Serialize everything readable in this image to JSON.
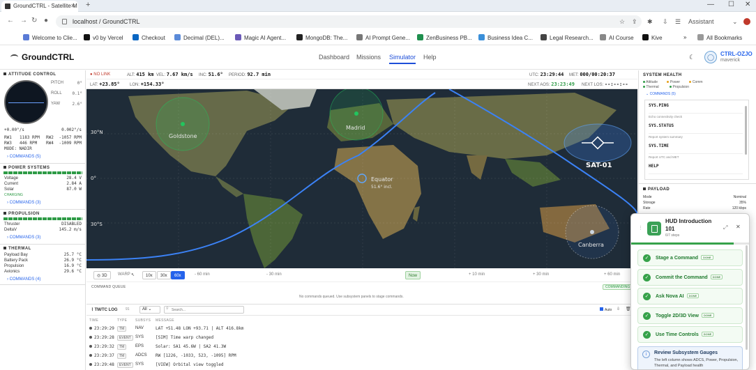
{
  "browser": {
    "tab_title": "GroundCTRL - Satellite M",
    "url": "localhost / GroundCTRL",
    "assistant_label": "Assistant",
    "bookmarks": [
      {
        "label": "Welcome to Clie...",
        "color": "#5a7bd6"
      },
      {
        "label": "v0 by Vercel",
        "color": "#111111"
      },
      {
        "label": "Checkout",
        "color": "#0a66c2"
      },
      {
        "label": "Decimal (DEL)...",
        "color": "#5b8bd9"
      },
      {
        "label": "Magic AI Agent...",
        "color": "#6b5ab8"
      },
      {
        "label": "MongoDB: The...",
        "color": "#222222"
      },
      {
        "label": "AI Prompt Gene...",
        "color": "#777777"
      },
      {
        "label": "ZenBusiness PB...",
        "color": "#1f8f4e"
      },
      {
        "label": "Business Idea C...",
        "color": "#3a8fd9"
      },
      {
        "label": "Legal Research...",
        "color": "#444444"
      },
      {
        "label": "AI Course",
        "color": "#888888"
      },
      {
        "label": "Kive",
        "color": "#111111"
      }
    ],
    "all_bookmarks": "All Bookmarks"
  },
  "app": {
    "name": "GroundCTRL",
    "nav": [
      "Dashboard",
      "Missions",
      "Simulator",
      "Help"
    ],
    "active_nav": "Simulator",
    "user_name": "CTRL-OZJO",
    "user_sub": "maverick"
  },
  "attitude": {
    "title": "ATTITUDE CONTROL",
    "pitch_label": "PITCH",
    "pitch": "0°",
    "roll_label": "ROLL",
    "roll": "0.1°",
    "yaw_label": "YAW",
    "yaw": "2.6°",
    "rate1": "+0.00°/s",
    "rate2": "0.002°/s",
    "rw1_label": "RW1",
    "rw1": "1183 RPM",
    "rw2_label": "RW2",
    "rw2": "-1057 RPM",
    "rw3_label": "RW3",
    "rw3": "446 RPM",
    "rw4_label": "RW4",
    "rw4": "-1009 RPM",
    "mode": "MODE: NADIR",
    "commands": "COMMANDS (5)"
  },
  "power": {
    "title": "POWER SYSTEMS",
    "voltage_label": "Voltage",
    "voltage": "28.4 V",
    "current_label": "Current",
    "current": "2.84 A",
    "solar_label": "Solar",
    "solar": "87.0 W",
    "status": "CHARGING",
    "commands": "COMMANDS (3)"
  },
  "propulsion": {
    "title": "PROPULSION",
    "thruster_label": "Thruster",
    "thruster": "DISABLED",
    "deltav_label": "DeltaV",
    "deltav": "145.2 m/s",
    "commands": "COMMANDS (3)"
  },
  "thermal": {
    "title": "THERMAL",
    "rows": [
      {
        "label": "Payload Bay",
        "value": "25.7 °C"
      },
      {
        "label": "Battery Pack",
        "value": "26.9 °C"
      },
      {
        "label": "Propulsion",
        "value": "16.9 °C"
      },
      {
        "label": "Avionics",
        "value": "29.6 °C"
      }
    ],
    "commands": "COMMANDS (4)"
  },
  "telemetry": {
    "link": "NO LINK",
    "alt_label": "ALT:",
    "alt": "415 km",
    "vel_label": "VEL:",
    "vel": "7.67 km/s",
    "inc_label": "INC:",
    "inc": "51.6°",
    "period_label": "PERIOD:",
    "period": "92.7 min",
    "utc_label": "UTC:",
    "utc": "23:29:44",
    "met_label": "MET:",
    "met": "000/00:20:37",
    "lat_label": "LAT:",
    "lat": "+23.85°",
    "lon_label": "LON:",
    "lon": "+154.33°",
    "next_aos_label": "NEXT AOS:",
    "next_aos": "23:23:49",
    "next_los_label": "NEXT LOS:",
    "next_los": "--:--:--"
  },
  "map": {
    "stations": [
      "Goldstone",
      "Madrid",
      "Canberra"
    ],
    "satellite": "SAT-01",
    "equator_label": "Equator",
    "incl_label": "51.6° incl.",
    "lat_labels": [
      "30°N",
      "0°",
      "30°S"
    ]
  },
  "timebar": {
    "view_3d": "3D",
    "warp_label": "WARP",
    "warp_options": [
      "10x",
      "30x",
      "60x"
    ],
    "active_warp": "60x",
    "ticks": [
      "- 60 min",
      "- 30 min",
      "Now",
      "+ 10 min",
      "+ 30 min",
      "+ 60 min"
    ]
  },
  "queue": {
    "title": "COMMAND QUEUE",
    "empty": "No commands queued. Use subsystem panels to stage commands.",
    "commanding": "COMMANDING"
  },
  "log": {
    "title": "TM/TC LOG",
    "count": "91",
    "filter": "All",
    "search_placeholder": "Search...",
    "auto": "Auto",
    "columns": [
      "TIME",
      "TYPE",
      "SUBSYS",
      "MESSAGE"
    ],
    "rows": [
      {
        "time": "23:29:29",
        "type": "TM",
        "sub": "NAV",
        "msg": "LAT +51.48 LON +93.71 | ALT 416.8km"
      },
      {
        "time": "23:29:28",
        "type": "EVENT",
        "sub": "SYS",
        "msg": "[SIM] Time warp changed"
      },
      {
        "time": "23:29:32",
        "type": "TM",
        "sub": "EPS",
        "msg": "Solar: SA1 45.6W | SA2 41.3W"
      },
      {
        "time": "23:29:37",
        "type": "TM",
        "sub": "ADCS",
        "msg": "RW [1226, -1033, 523, -1095] RPM"
      },
      {
        "time": "23:29:48",
        "type": "EVENT",
        "sub": "SYS",
        "msg": "[VIEW] Orbital view toggled"
      }
    ]
  },
  "system_health": {
    "title": "SYSTEM HEALTH",
    "legend": [
      "Attitude",
      "Power",
      "Comm",
      "Thermal",
      "Propulsion"
    ],
    "commands": "COMMANDS (5)",
    "items": [
      {
        "cmd": "SYS.PING",
        "desc": "Echo connectivity check"
      },
      {
        "cmd": "SYS.STATUS",
        "desc": "Report system summary"
      },
      {
        "cmd": "SYS.TIME",
        "desc": "Report UTC and MET"
      },
      {
        "cmd": "HELP",
        "desc": ""
      }
    ]
  },
  "payload": {
    "title": "PAYLOAD",
    "mode_label": "Mode",
    "mode": "Nominal",
    "storage_label": "Storage",
    "storage": "35%",
    "rate_label": "Rate",
    "rate": "120 kbps"
  },
  "hud": {
    "title": "HUD Introduction 101",
    "steps_count": "6/7 steps",
    "progress": 0.86,
    "done_label": "DONE",
    "steps": [
      "Stage a Command",
      "Commit the Command",
      "Ask Nova AI",
      "Toggle 2D/3D View",
      "Use Time Controls"
    ],
    "current_title": "Review Subsystem Gauges",
    "current_desc": "The left column shows ADCS, Power, Propulsion, Thermal, and Payload health"
  }
}
